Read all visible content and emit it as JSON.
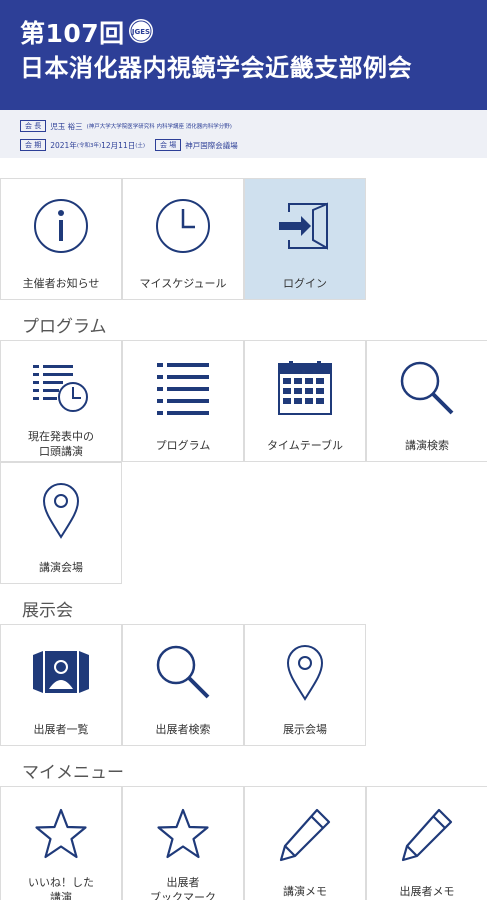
{
  "header": {
    "title_line1": "第107回",
    "title_line2": "日本消化器内視鏡学会近畿支部例会",
    "logo_text": "JGES"
  },
  "info": {
    "president_tag": "会 長",
    "president_name": "児玉 裕三",
    "president_affil": "(神戸大学大学院医学研究科 内科学講座 消化器内科学分野)",
    "date_tag": "会 期",
    "date_value": "2021年",
    "date_note": "(令和3年)",
    "date_value2": "12月11日",
    "date_day": "(土)",
    "venue_tag": "会 場",
    "venue_value": "神戸国際会議場"
  },
  "top_tiles": [
    {
      "label": "主催者お知らせ",
      "icon": "info-icon"
    },
    {
      "label": "マイスケジュール",
      "icon": "clock-icon"
    },
    {
      "label": "ログイン",
      "icon": "login-icon"
    }
  ],
  "sections": {
    "program": "プログラム",
    "exhibition": "展示会",
    "mymenu": "マイメニュー"
  },
  "program_tiles": [
    {
      "label_line1": "現在発表中の",
      "label_line2": "口頭講演",
      "icon": "current-talk-icon"
    },
    {
      "label": "プログラム",
      "icon": "list-icon"
    },
    {
      "label": "タイムテーブル",
      "icon": "calendar-icon"
    },
    {
      "label": "講演検索",
      "icon": "search-icon"
    },
    {
      "label": "講演会場",
      "icon": "map-pin-icon"
    }
  ],
  "exhibition_tiles": [
    {
      "label": "出展者一覧",
      "icon": "exhibitor-icon"
    },
    {
      "label": "出展者検索",
      "icon": "search-icon"
    },
    {
      "label": "展示会場",
      "icon": "map-pin-icon"
    }
  ],
  "mymenu_tiles": [
    {
      "label_line1": "いいね！した",
      "label_line2": "講演",
      "icon": "star-icon"
    },
    {
      "label_line1": "出展者",
      "label_line2": "ブックマーク",
      "icon": "star-icon"
    },
    {
      "label": "講演メモ",
      "icon": "pencil-icon"
    },
    {
      "label": "出展者メモ",
      "icon": "pencil-icon"
    }
  ],
  "colors": {
    "header_bg": "#2d3f97",
    "icon": "#1f3a7a",
    "active_tile": "#cfe0ee"
  }
}
